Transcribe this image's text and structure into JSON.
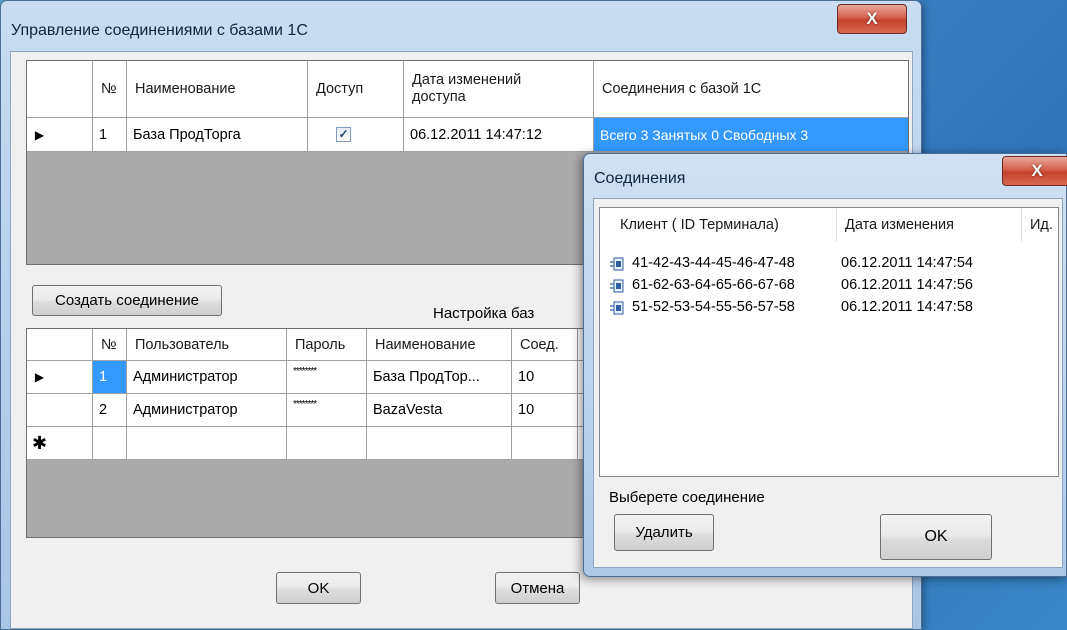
{
  "main_window": {
    "title": "Управление соединениями с базами 1С",
    "close_glyph": "X",
    "databases_grid": {
      "columns": [
        "№",
        "Наименование",
        "Доступ",
        "Дата изменений доступа",
        "Соединения с базой 1С"
      ],
      "rows": [
        {
          "num": "1",
          "name": "База ПродТорга",
          "access": true,
          "access_mark": "✓",
          "date": "06.12.2011 14:47:12",
          "connections": "Всего 3  Занятых 0  Свободных 3"
        }
      ]
    },
    "create_connection_button": "Создать соединение",
    "settings_label": "Настройка  баз",
    "users_grid": {
      "columns": [
        "№",
        "Пользователь",
        "Пароль",
        "Наименование",
        "Соед."
      ],
      "rows": [
        {
          "num": "1",
          "user": "Администратор",
          "password": "********",
          "name": "База ПродТор...",
          "conn": "10"
        },
        {
          "num": "2",
          "user": "Администратор",
          "password": "********",
          "name": "BazaVesta",
          "conn": "10"
        }
      ],
      "new_row_marker": "✱"
    },
    "ok_button": "OK",
    "cancel_button": "Отмена"
  },
  "connections_dialog": {
    "title": "Соединения",
    "close_glyph": "X",
    "columns": [
      "Клиент ( ID Терминала)",
      "Дата изменения",
      "Ид."
    ],
    "items": [
      {
        "client": "41-42-43-44-45-46-47-48",
        "date": "06.12.2011 14:47:54"
      },
      {
        "client": "61-62-63-64-65-66-67-68",
        "date": "06.12.2011 14:47:56"
      },
      {
        "client": "51-52-53-54-55-56-57-58",
        "date": "06.12.2011 14:47:58"
      }
    ],
    "hint": "Выберете соединение",
    "delete_button": "Удалить",
    "ok_button": "OK"
  },
  "colors": {
    "selection": "#3399ff",
    "grid_background": "#ababab",
    "title_bar": "#bcd4ed",
    "close_button": "#c4432e"
  }
}
